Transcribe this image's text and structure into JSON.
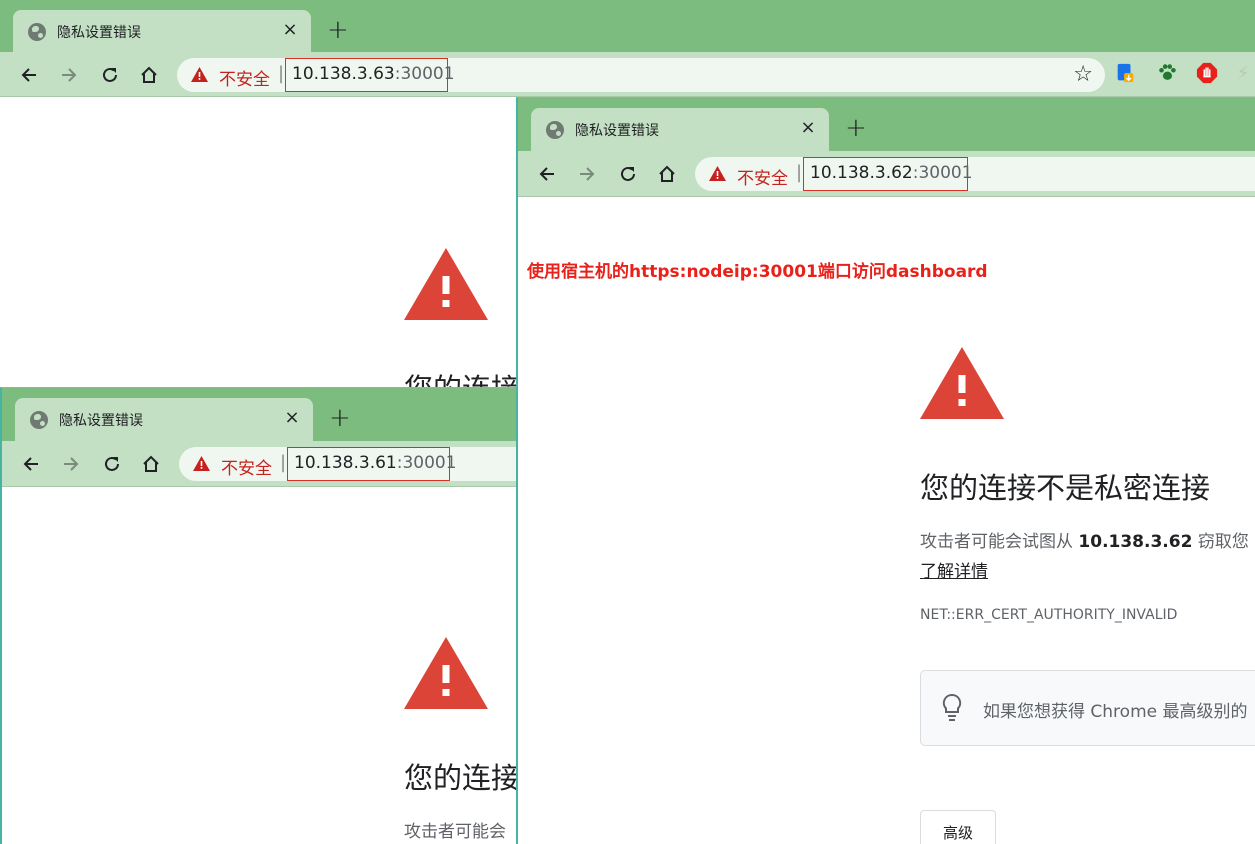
{
  "windows": {
    "back": {
      "tab_title": "隐私设置错误",
      "close_glyph": "×",
      "newtab_glyph": "+",
      "insecure_label": "不安全",
      "separator": "|",
      "url_host": "10.138.3.63",
      "url_port": ":30001",
      "heading": "您的连接"
    },
    "middle": {
      "tab_title": "隐私设置错误",
      "close_glyph": "×",
      "newtab_glyph": "+",
      "insecure_label": "不安全",
      "separator": "|",
      "url_host": "10.138.3.61",
      "url_port": ":30001",
      "heading": "您的连接",
      "desc": "攻击者可能会"
    },
    "front": {
      "tab_title": "隐私设置错误",
      "close_glyph": "×",
      "newtab_glyph": "+",
      "insecure_label": "不安全",
      "separator": "|",
      "url_host": "10.138.3.62",
      "url_port": ":30001",
      "annotation": "使用宿主机的https:nodeip:30001端口访问dashboard",
      "heading": "您的连接不是私密连接",
      "desc_prefix": "攻击者可能会试图从 ",
      "desc_host": "10.138.3.62",
      "desc_suffix": " 窃取您",
      "learn_more": "了解详情",
      "error_code": "NET::ERR_CERT_AUTHORITY_INVALID",
      "tip_text": "如果您想获得 Chrome 最高级别的",
      "advanced_button": "高级"
    }
  },
  "icons": {
    "back": "arrow-left",
    "forward": "arrow-right",
    "reload": "reload",
    "home": "home",
    "warning": "warning-triangle",
    "star": "star-outline",
    "bulb": "lightbulb"
  },
  "colors": {
    "tabstrip": "#7cbc7e",
    "toolbar": "#c3e0c4",
    "warning_red": "#db4437",
    "insecure_red": "#c5221f",
    "annotation_red": "#e8221b",
    "highlight_box": "#d93025"
  }
}
